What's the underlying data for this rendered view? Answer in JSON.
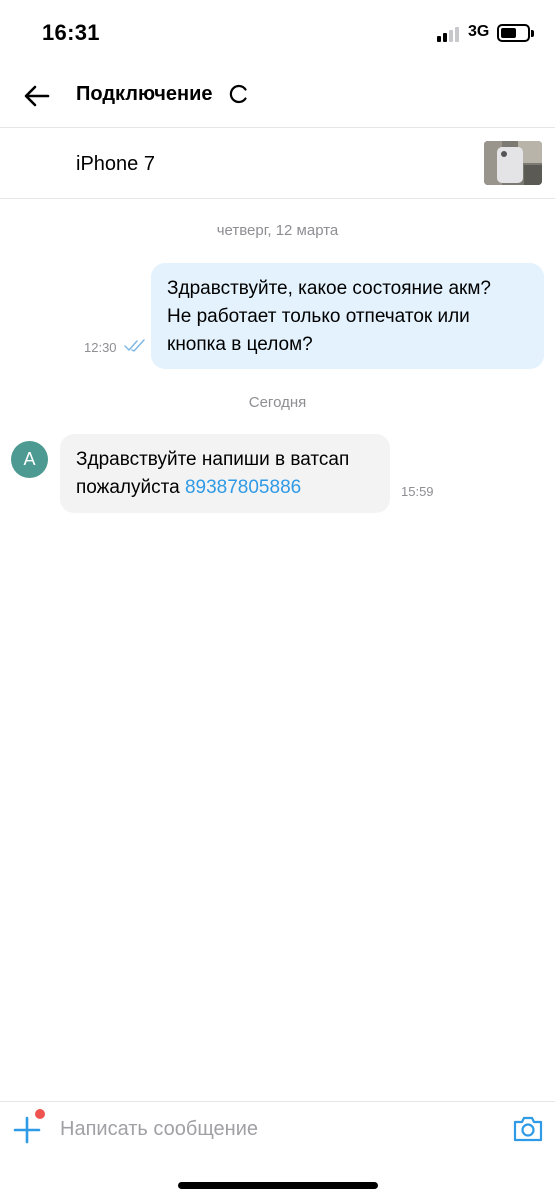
{
  "status_bar": {
    "time": "16:31",
    "network": "3G"
  },
  "header": {
    "title": "Подключение"
  },
  "item": {
    "title": "iPhone 7"
  },
  "chat": {
    "date1": "четверг, 12 марта",
    "date2": "Сегодня",
    "outgoing": {
      "lines": [
        "Здравствуйте, какое состояние акм?",
        "Не работает только отпечаток или",
        "кнопка в целом?"
      ],
      "time": "12:30"
    },
    "incoming": {
      "avatar_letter": "A",
      "line1": "Здравствуйте напиши в ватсап",
      "line2_text": "пожалуйста",
      "phone": "89387805886",
      "time": "15:59"
    }
  },
  "input": {
    "placeholder": "Написать сообщение"
  },
  "colors": {
    "accent": "#2f9ae6",
    "outgoing_bubble": "#e3f2fd",
    "incoming_bubble": "#f3f3f3",
    "avatar": "#4c9a91",
    "notification_dot": "#ef5350"
  },
  "icons": [
    "back-arrow-icon",
    "loading-spinner-icon",
    "double-check-icon",
    "plus-icon",
    "camera-icon"
  ]
}
